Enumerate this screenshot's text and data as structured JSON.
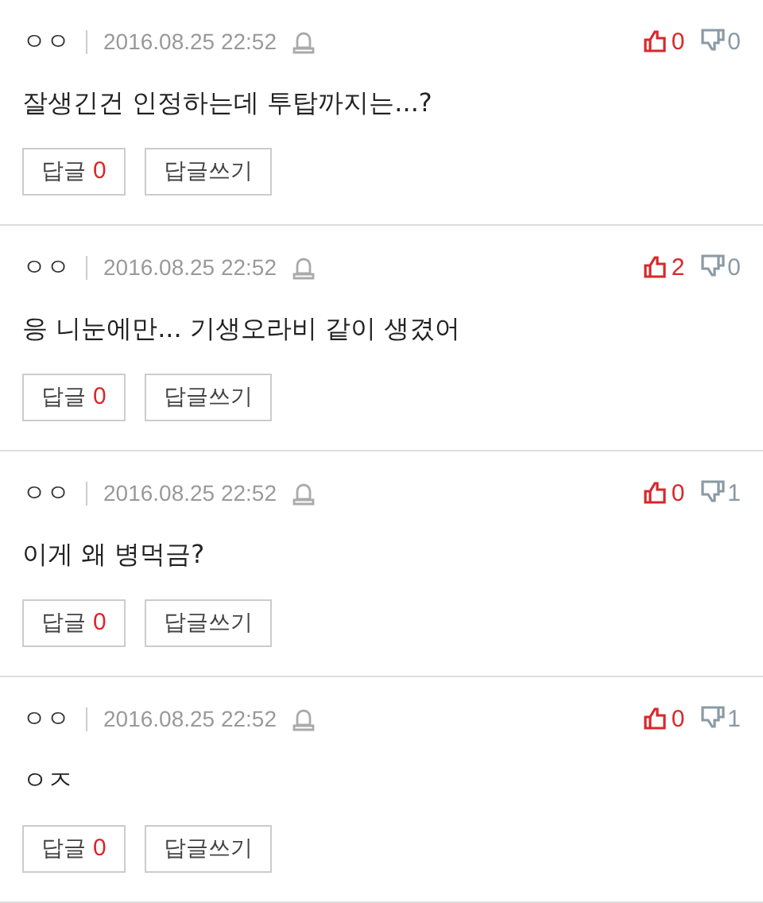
{
  "comments": [
    {
      "author": "ㅇㅇ",
      "date": "2016.08.25 22:52",
      "likes": "0",
      "dislikes": "0",
      "text": "잘생긴건 인정하는데 투탑까지는...?",
      "reply_label": "답글",
      "reply_count": "0",
      "write_label": "답글쓰기"
    },
    {
      "author": "ㅇㅇ",
      "date": "2016.08.25 22:52",
      "likes": "2",
      "dislikes": "0",
      "text": "응 니눈에만... 기생오라비 같이 생겼어",
      "reply_label": "답글",
      "reply_count": "0",
      "write_label": "답글쓰기"
    },
    {
      "author": "ㅇㅇ",
      "date": "2016.08.25 22:52",
      "likes": "0",
      "dislikes": "1",
      "text": "이게 왜 병먹금?",
      "reply_label": "답글",
      "reply_count": "0",
      "write_label": "답글쓰기"
    },
    {
      "author": "ㅇㅇ",
      "date": "2016.08.25 22:52",
      "likes": "0",
      "dislikes": "1",
      "text": "ㅇㅈ",
      "reply_label": "답글",
      "reply_count": "0",
      "write_label": "답글쓰기"
    }
  ]
}
